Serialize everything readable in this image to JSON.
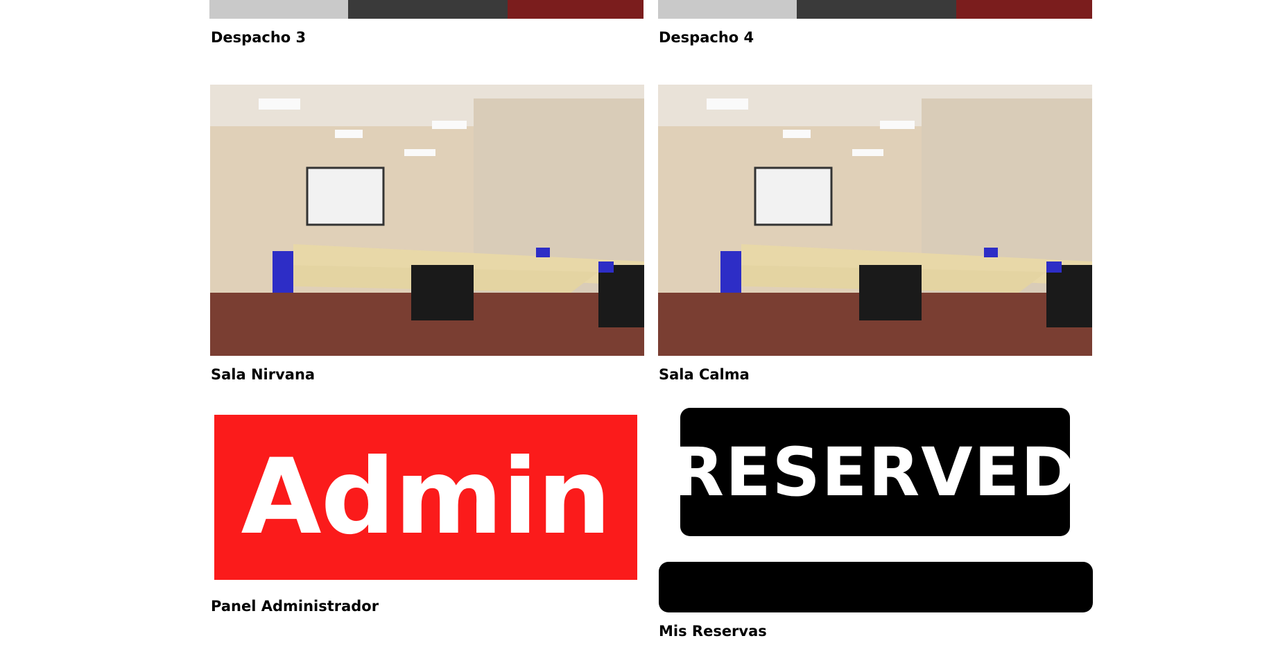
{
  "cards": {
    "despacho3": {
      "title": "Despacho 3"
    },
    "despacho4": {
      "title": "Despacho 4"
    },
    "sala_nirvana": {
      "title": "Sala Nirvana"
    },
    "sala_calma": {
      "title": "Sala Calma"
    },
    "panel_admin": {
      "title": "Panel Administrador",
      "logo_text": "Admin"
    },
    "mis_reservas": {
      "title": "Mis Reservas",
      "sign_text": "RESERVED"
    }
  },
  "colors": {
    "admin_red": "#fb1b1b",
    "reserved_black": "#000000"
  }
}
